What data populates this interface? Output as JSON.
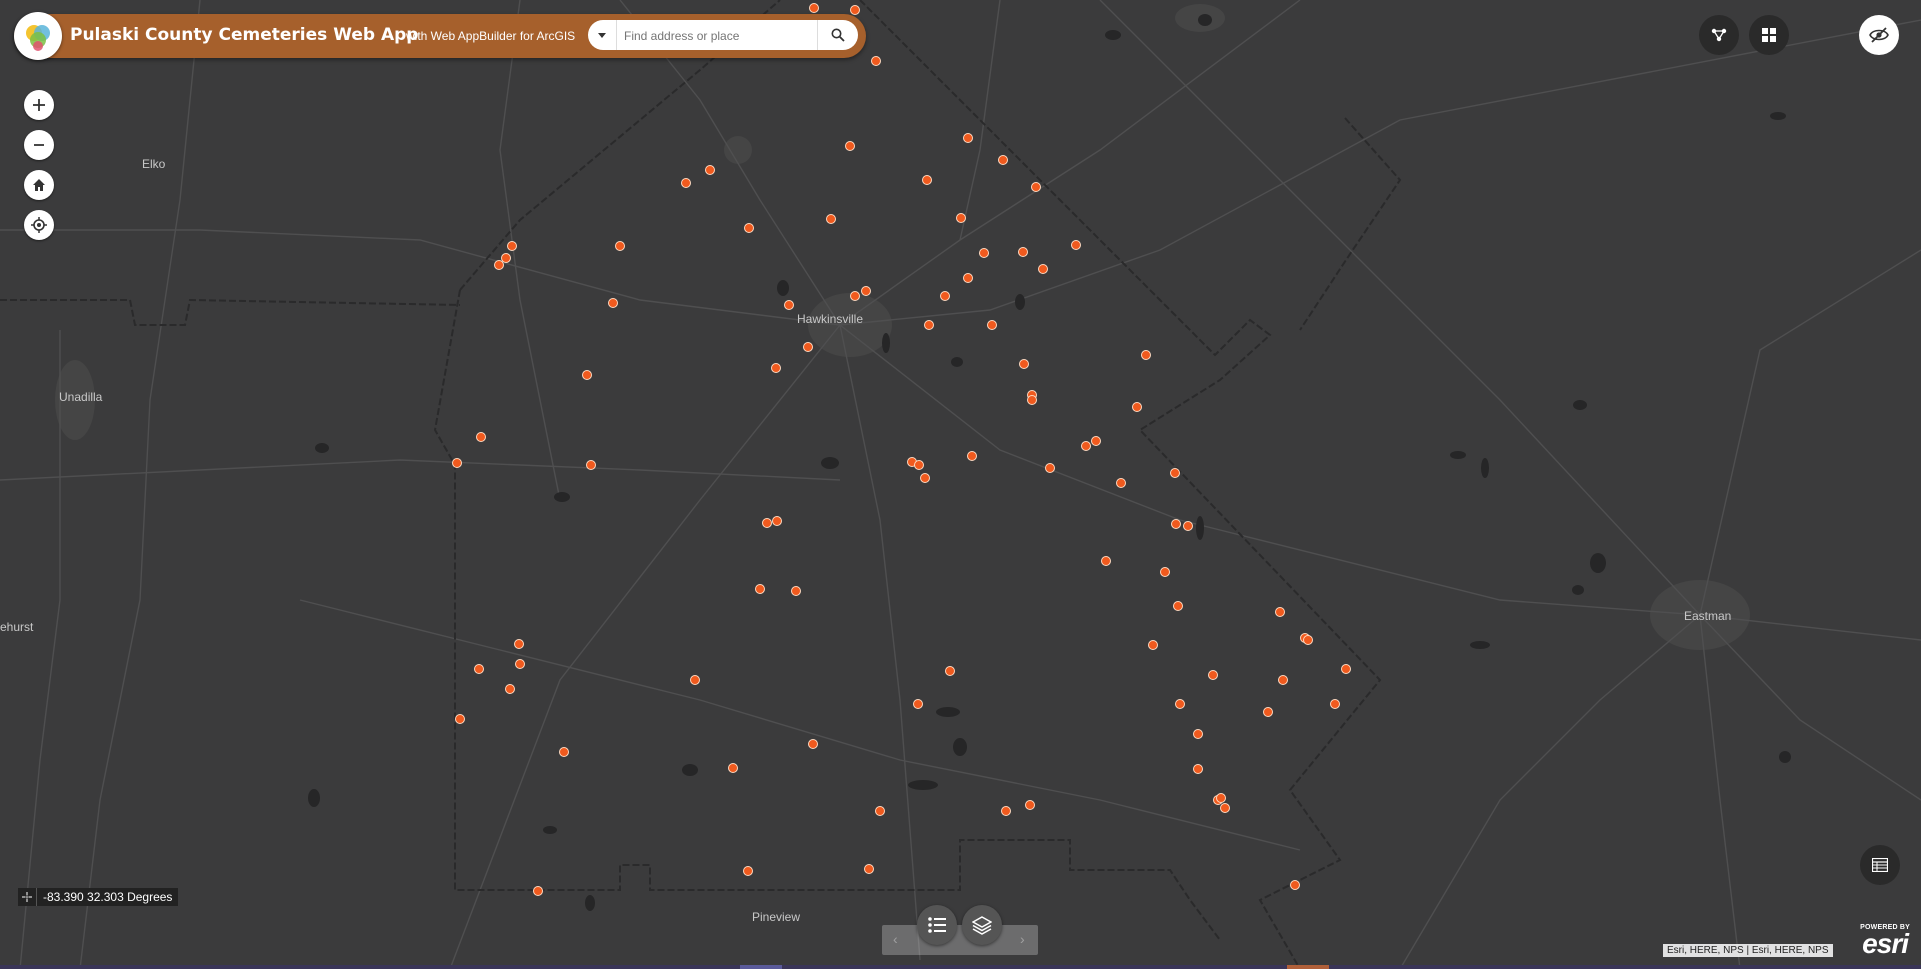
{
  "header": {
    "title": "Pulaski County Cemeteries Web App",
    "subtitle": "with Web AppBuilder for ArcGIS",
    "search_placeholder": "Find address or place"
  },
  "controls": {
    "zoom_in_icon": "plus-icon",
    "zoom_out_icon": "minus-icon",
    "home_icon": "home-icon",
    "locate_icon": "locate-icon"
  },
  "toolbar": {
    "icons": [
      "share-icon",
      "widgets-grid-icon",
      "eye-slash-icon"
    ]
  },
  "coordinates": {
    "text": "-83.390 32.303 Degrees"
  },
  "attribution": "Esri, HERE, NPS | Esri, HERE, NPS",
  "esri_logo": {
    "powered_by": "POWERED BY",
    "brand": "esri"
  },
  "bottom_controls": {
    "prev": "‹",
    "next": "›",
    "icons": [
      "legend-icon",
      "layers-icon"
    ]
  },
  "attribute_table_icon": "table-icon",
  "map": {
    "places": [
      "Elko",
      "Unadilla",
      "Hawkinsville",
      "Eastman",
      "ehurst",
      "Pineview"
    ],
    "marker_color": "#f05a1e",
    "background_color": "#3b3b3c"
  }
}
